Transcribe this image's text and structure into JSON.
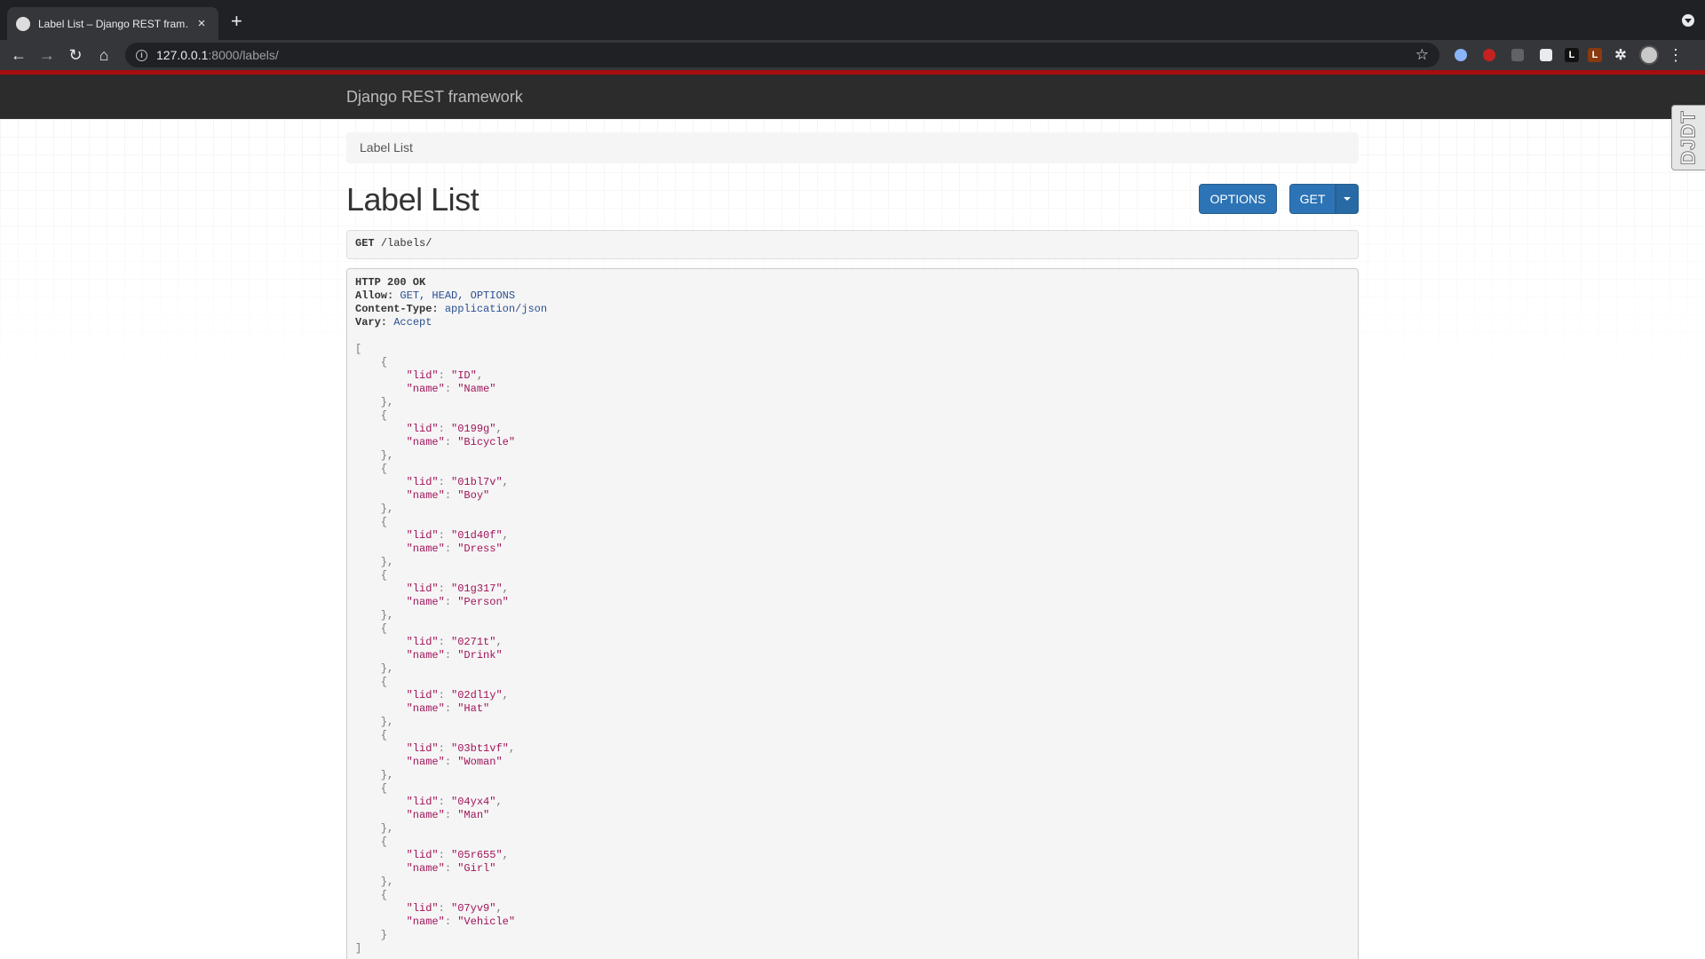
{
  "browser": {
    "tab_title": "Label List – Django REST fram…",
    "new_tab": "+",
    "close": "×",
    "url_host": "127.0.0.1",
    "url_path": ":8000/labels/",
    "extensions": [
      "ext-1",
      "ext-ublock",
      "ext-3",
      "ext-notion",
      "L",
      "L"
    ]
  },
  "navbar": {
    "brand": "Django REST framework"
  },
  "breadcrumb": {
    "label": "Label List"
  },
  "page": {
    "title": "Label List",
    "options_label": "OPTIONS",
    "get_label": "GET"
  },
  "request": {
    "method": "GET",
    "path": "/labels/"
  },
  "response": {
    "status": "HTTP 200 OK",
    "headers": [
      {
        "key": "Allow:",
        "value": "GET, HEAD, OPTIONS"
      },
      {
        "key": "Content-Type:",
        "value": "application/json"
      },
      {
        "key": "Vary:",
        "value": "Accept"
      }
    ],
    "items": [
      {
        "lid": "ID",
        "name": "Name"
      },
      {
        "lid": "0199g",
        "name": "Bicycle"
      },
      {
        "lid": "01bl7v",
        "name": "Boy"
      },
      {
        "lid": "01d40f",
        "name": "Dress"
      },
      {
        "lid": "01g317",
        "name": "Person"
      },
      {
        "lid": "0271t",
        "name": "Drink"
      },
      {
        "lid": "02dl1y",
        "name": "Hat"
      },
      {
        "lid": "03bt1vf",
        "name": "Woman"
      },
      {
        "lid": "04yx4",
        "name": "Man"
      },
      {
        "lid": "05r655",
        "name": "Girl"
      },
      {
        "lid": "07yv9",
        "name": "Vehicle"
      }
    ]
  },
  "djdt": {
    "label": "DJDT"
  }
}
